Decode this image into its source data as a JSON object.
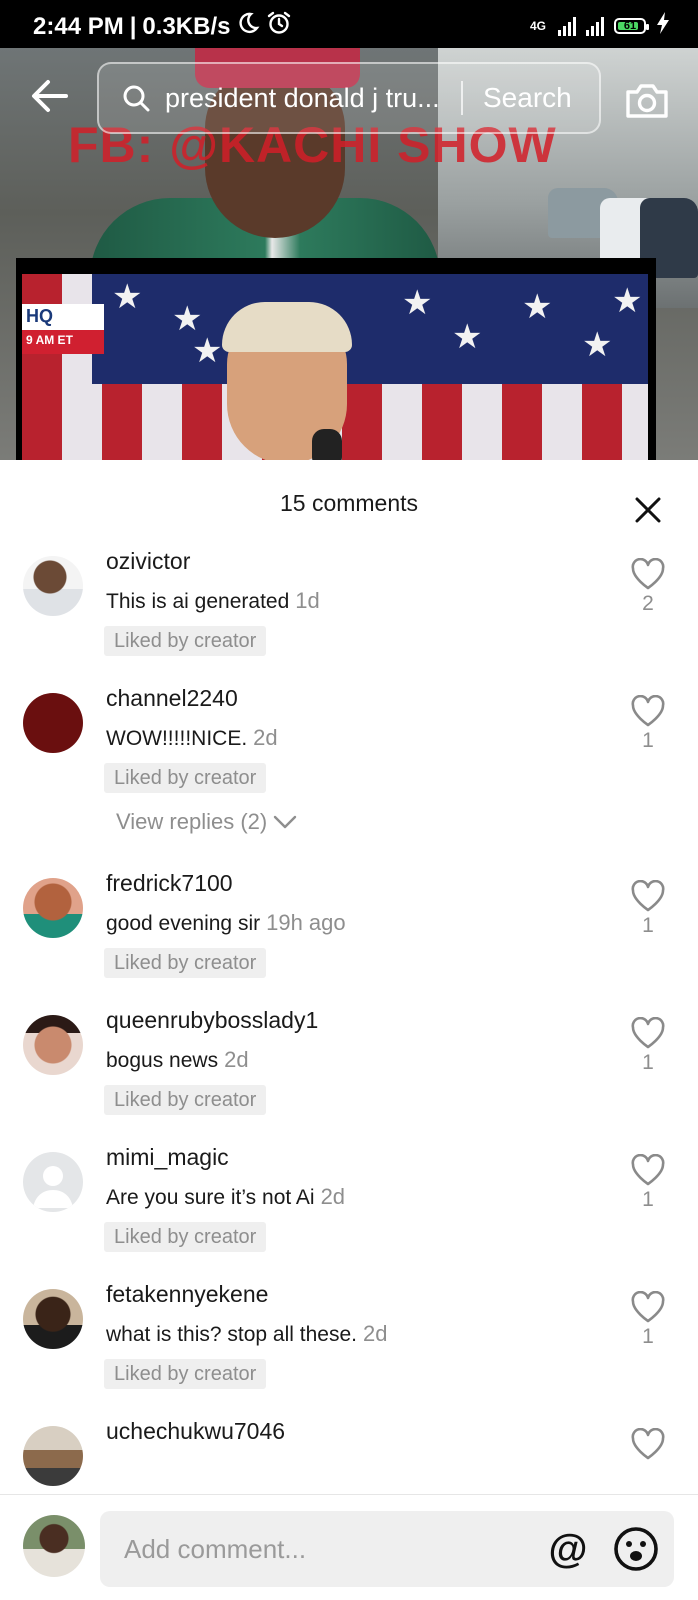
{
  "status_bar": {
    "time": "2:44 PM",
    "speed": "0.3KB/s",
    "network": "4G",
    "battery": "61",
    "icons": [
      "moon-icon",
      "alarm-icon",
      "signal-icon",
      "battery-icon",
      "charging-icon"
    ]
  },
  "video": {
    "watermark": "FB: @KACHI SHOW",
    "inset_badge_top": "HQ",
    "inset_badge_bottom": "9 AM ET"
  },
  "search": {
    "query": "president donald j tru...",
    "button_label": "Search"
  },
  "comments_sheet": {
    "title": "15 comments",
    "liked_by_label": "Liked by creator",
    "comments": [
      {
        "username": "ozivictor",
        "text": "This is ai generated",
        "time": "1d",
        "likes": "2",
        "liked_by_creator": true
      },
      {
        "username": "channel2240",
        "text": "WOW!!!!!NICE.",
        "time": "2d",
        "likes": "1",
        "liked_by_creator": true,
        "view_replies": "View replies (2)"
      },
      {
        "username": "fredrick7100",
        "text": "good evening sir",
        "time": "19h ago",
        "likes": "1",
        "liked_by_creator": true
      },
      {
        "username": "queenrubybosslady1",
        "text": "bogus news",
        "time": "2d",
        "likes": "1",
        "liked_by_creator": true
      },
      {
        "username": "mimi_magic",
        "text": "Are you sure it’s not Ai",
        "time": "2d",
        "likes": "1",
        "liked_by_creator": true
      },
      {
        "username": "fetakennyekene",
        "text": "what is this? stop all these.",
        "time": "2d",
        "likes": "1",
        "liked_by_creator": true
      },
      {
        "username": "uchechukwu7046",
        "text": "",
        "time": "",
        "likes": "",
        "liked_by_creator": false
      }
    ]
  },
  "composer": {
    "placeholder": "Add comment...",
    "mention_symbol": "@"
  },
  "colors": {
    "status_bar_bg": "#000000",
    "muted_text": "#8e8e8e",
    "liked_badge_bg": "#efefef",
    "watermark_red": "#d21e28",
    "battery_green": "#4cd964"
  }
}
